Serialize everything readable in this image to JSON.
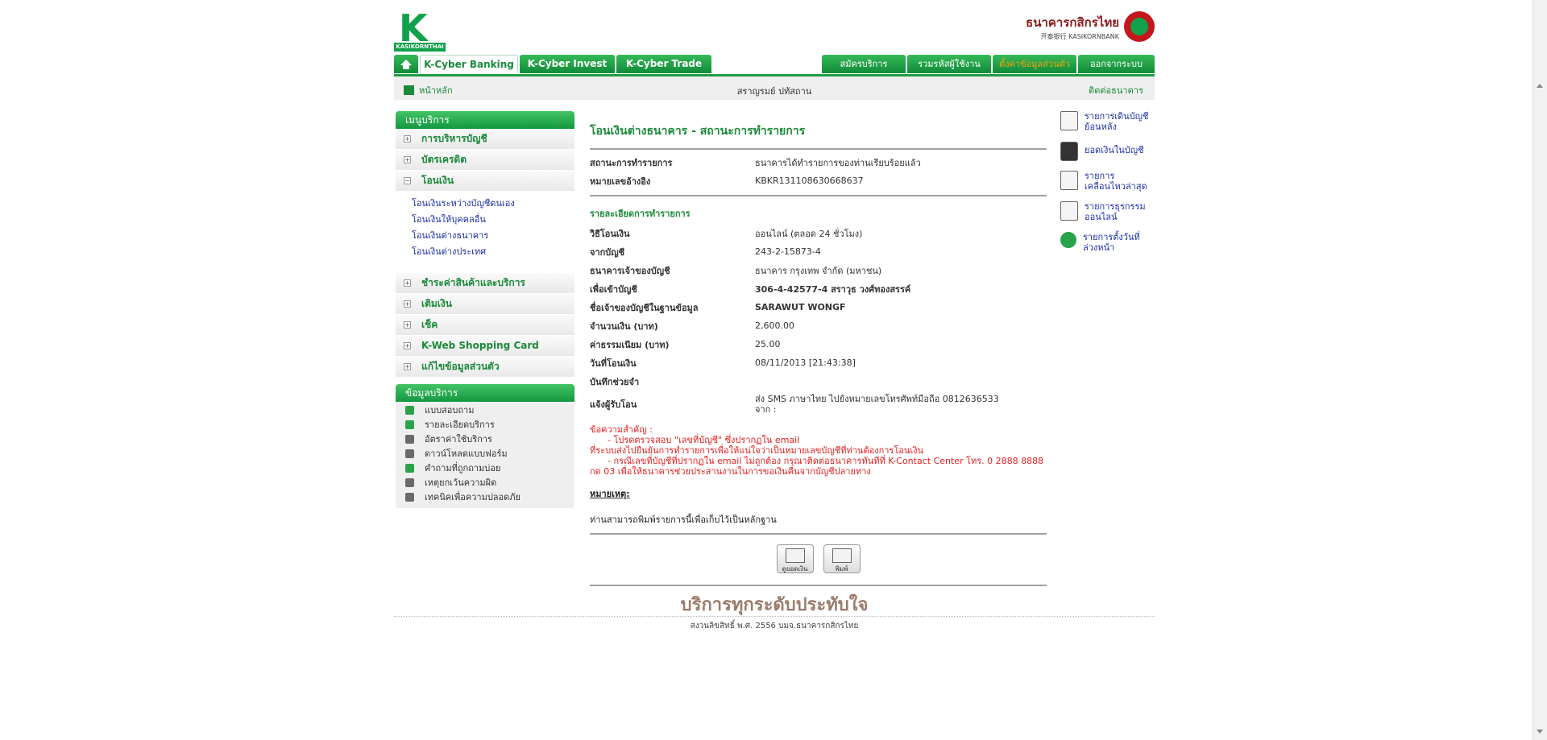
{
  "header": {
    "logo_name": "KASIKORNTHAI",
    "bank_th": "ธนาคารกสิกรไทย",
    "bank_en": "开泰银行 KASIKORNBANK"
  },
  "nav": {
    "tabs": [
      "K-Cyber Banking",
      "K-Cyber Invest",
      "K-Cyber Trade"
    ],
    "right": [
      "สมัครบริการ",
      "รวมรหัสผู้ใช้งาน",
      "ตั้งค่าข้อมูลส่วนตัว",
      "ออกจากระบบ"
    ]
  },
  "subbar": {
    "home": "หน้าหลัก",
    "user": "สราญรมย์ ปทัสถาน",
    "contact": "ติดต่อธนาคาร"
  },
  "menu": {
    "title": "เมนูบริการ",
    "items": [
      "การบริหารบัญชี",
      "บัตรเครดิต",
      "โอนเงิน"
    ],
    "transfer_sub": [
      "โอนเงินระหว่างบัญชีตนเอง",
      "โอนเงินให้บุคคลอื่น",
      "โอนเงินต่างธนาคาร",
      "โอนเงินต่างประเทศ"
    ],
    "items2": [
      "ชำระค่าสินค้าและบริการ",
      "เติมเงิน",
      "เช็ค",
      "K-Web Shopping Card",
      "แก้ไขข้อมูลส่วนตัว"
    ]
  },
  "info": {
    "title": "ข้อมูลบริการ",
    "items": [
      "แบบสอบถาม",
      "รายละเอียดบริการ",
      "อัตราค่าใช้บริการ",
      "ดาวน์โหลดแบบฟอร์ม",
      "คำถามที่ถูกถามบ่อย",
      "เหตุยกเว้นความผิด",
      "เทคนิคเพื่อความปลอดภัย"
    ]
  },
  "main": {
    "title": "โอนเงินต่างธนาคาร - สถานะการทำรายการ",
    "status_label": "สถานะการทำรายการ",
    "status_value": "ธนาคารได้ทำรายการของท่านเรียบร้อยแล้ว",
    "ref_label": "หมายเลขอ้างอิง",
    "ref_value": "KBKR131108630668637",
    "section": "รายละเอียดการทำรายการ",
    "rows": [
      {
        "k": "วิธีโอนเงิน",
        "v": "ออนไลน์ (ตลอด 24 ชั่วโมง)"
      },
      {
        "k": "จากบัญชี",
        "v": "243-2-15873-4"
      },
      {
        "k": "ธนาคารเจ้าของบัญชี",
        "v": "ธนาคาร กรุงเทพ จำกัด (มหาชน)"
      },
      {
        "k": "เพื่อเข้าบัญชี",
        "v": "306-4-42577-4 สราวุธ วงศ์ทองสรรค์"
      },
      {
        "k": "ชื่อเจ้าของบัญชีในฐานข้อมูล",
        "v": "SARAWUT WONGF"
      },
      {
        "k": "จำนวนเงิน (บาท)",
        "v": "2,600.00"
      },
      {
        "k": "ค่าธรรมเนียม (บาท)",
        "v": "25.00"
      },
      {
        "k": "วันที่โอนเงิน",
        "v": "08/11/2013 [21:43:38]"
      },
      {
        "k": "บันทึกช่วยจำ",
        "v": ""
      }
    ],
    "notify_label": "แจ้งผู้รับโอน",
    "notify_value_1": "ส่ง SMS ภาษาไทย ไปยังหมายเลขโทรศัพท์มือถือ 0812636533",
    "notify_value_2": "จาก :",
    "warn": [
      "ข้อความสำคัญ :",
      "- โปรดตรวจสอบ \"เลขที่บัญชี\" ซึ่งปรากฏใน email",
      "ที่ระบบส่งไปยืนยันการทำรายการเพื่อให้แน่ใจว่าเป็นหมายเลขบัญชีที่ท่านต้องการโอนเงิน",
      "- กรณีเลขที่บัญชีที่ปรากฏใน email ไม่ถูกต้อง กรุณาติดต่อธนาคารทันทีที่ K-Contact Center โทร. 0 2888 8888",
      "กด 03 เพื่อให้ธนาคารช่วยประสานงานในการขอเงินคืนจากบัญชีปลายทาง"
    ],
    "note_title": "หมายเหตุ:",
    "note_text": "ท่านสามารถพิมพ์รายการนี้เพื่อเก็บไว้เป็นหลักฐาน",
    "btn_balance": "ดูยอดเงิน",
    "btn_print": "พิมพ์"
  },
  "rail": [
    "รายการเดินบัญชีย้อนหลัง",
    "ยอดเงินในบัญชี",
    "รายการเคลื่อนไหวล่าสุด",
    "รายการธุรกรรมออนไลน์",
    "รายการตั้งวันที่ล่วงหน้า"
  ],
  "footer": {
    "slogan": "บริการทุกระดับประทับใจ",
    "copyright": "สงวนลิขสิทธิ์ พ.ศ. 2556 บมจ.ธนาคารกสิกรไทย"
  }
}
